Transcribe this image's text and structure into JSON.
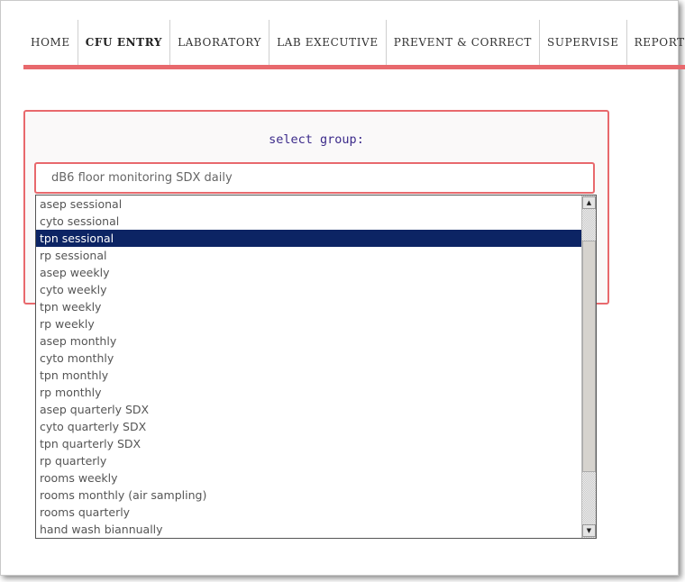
{
  "nav": {
    "items": [
      "HOME",
      "CFU ENTRY",
      "LABORATORY",
      "LAB EXECUTIVE",
      "PREVENT & CORRECT",
      "SUPERVISE",
      "REPORTING"
    ],
    "active_index": 1
  },
  "panel": {
    "title": "select group:"
  },
  "select": {
    "value": "dB6 floor monitoring SDX daily",
    "selected_option": "tpn sessional",
    "options": [
      "asep sessional",
      "cyto sessional",
      "tpn sessional",
      "rp sessional",
      "asep weekly",
      "cyto weekly",
      "tpn weekly",
      "rp weekly",
      "asep monthly",
      "cyto monthly",
      "tpn monthly",
      "rp monthly",
      "asep quarterly SDX",
      "cyto quarterly SDX",
      "tpn quarterly SDX",
      "rp quarterly",
      "rooms weekly",
      "rooms monthly (air sampling)",
      "rooms quarterly",
      "hand wash biannually"
    ]
  },
  "scrollbar": {
    "up_icon": "▲",
    "down_icon": "▼"
  },
  "colors": {
    "accent": "#e8696d",
    "selected_bg": "#0c2464",
    "title_text": "#3b2a8a"
  }
}
